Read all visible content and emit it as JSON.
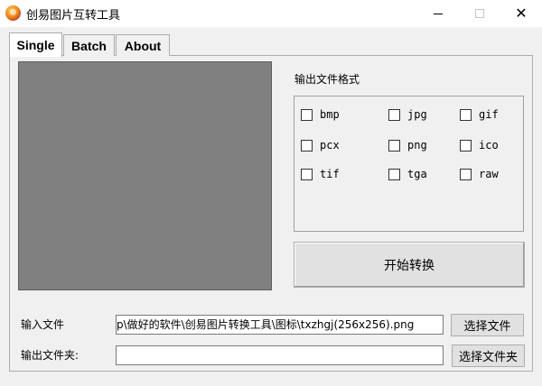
{
  "window": {
    "title": "创易图片互转工具",
    "icons": {
      "app": "app-logo-icon",
      "minimize": "minimize-icon",
      "maximize": "maximize-icon",
      "close": "close-icon"
    },
    "close_glyph": "✕"
  },
  "tabs": [
    {
      "label": "Single",
      "active": true
    },
    {
      "label": "Batch",
      "active": false
    },
    {
      "label": "About",
      "active": false
    }
  ],
  "formats": {
    "label": "输出文件格式",
    "options": [
      {
        "label": "bmp",
        "checked": false
      },
      {
        "label": "jpg",
        "checked": false
      },
      {
        "label": "gif",
        "checked": false
      },
      {
        "label": "pcx",
        "checked": false
      },
      {
        "label": "png",
        "checked": false
      },
      {
        "label": "ico",
        "checked": false
      },
      {
        "label": "tif",
        "checked": false
      },
      {
        "label": "tga",
        "checked": false
      },
      {
        "label": "raw",
        "checked": false
      }
    ]
  },
  "actions": {
    "convert_label": "开始转换",
    "select_file_label": "选择文件",
    "select_folder_label": "选择文件夹"
  },
  "input_file": {
    "label": "输入文件",
    "value": "p\\做好的软件\\创易图片转换工具\\图标\\txzhgj(256x256).png"
  },
  "output_folder": {
    "label": "输出文件夹:",
    "value": ""
  },
  "colors": {
    "preview_bg": "#808080",
    "window_bg": "#f0f0f0"
  }
}
